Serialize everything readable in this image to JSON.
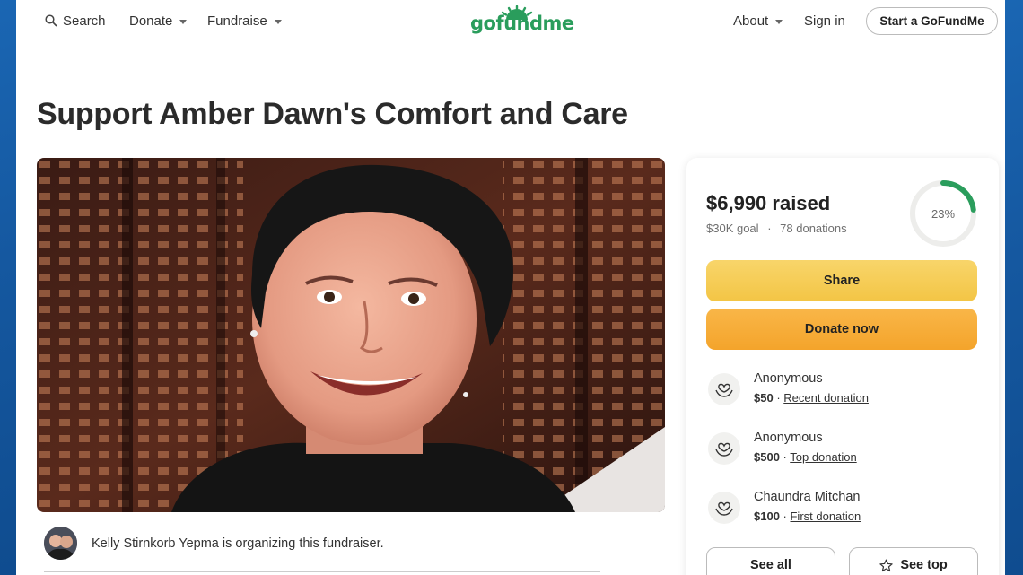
{
  "header": {
    "search_label": "Search",
    "donate_label": "Donate",
    "fundraise_label": "Fundraise",
    "logo_text": "gofundme",
    "about_label": "About",
    "signin_label": "Sign in",
    "start_label": "Start a GoFundMe"
  },
  "campaign": {
    "title": "Support Amber Dawn's Comfort and Care",
    "organizer_text": "Kelly Stirnkorb Yepma is organizing this fundraiser."
  },
  "progress": {
    "raised": "$6,990 raised",
    "goal": "$30K goal",
    "separator": "·",
    "donations": "78 donations",
    "percent_label": "23%",
    "percent_value": 0.23
  },
  "actions": {
    "share_label": "Share",
    "donate_label": "Donate now",
    "see_all_label": "See all",
    "see_top_label": "See top"
  },
  "donations": [
    {
      "name": "Anonymous",
      "amount": "$50",
      "dot": " · ",
      "tag": "Recent donation"
    },
    {
      "name": "Anonymous",
      "amount": "$500",
      "dot": " · ",
      "tag": "Top donation"
    },
    {
      "name": "Chaundra Mitchan",
      "amount": "$100",
      "dot": " · ",
      "tag": "First donation"
    }
  ],
  "colors": {
    "brand_green": "#2a9d5c",
    "share_yellow": "#f3c545",
    "donate_orange": "#f4a42b",
    "background_blue": "#1b5fa6"
  }
}
